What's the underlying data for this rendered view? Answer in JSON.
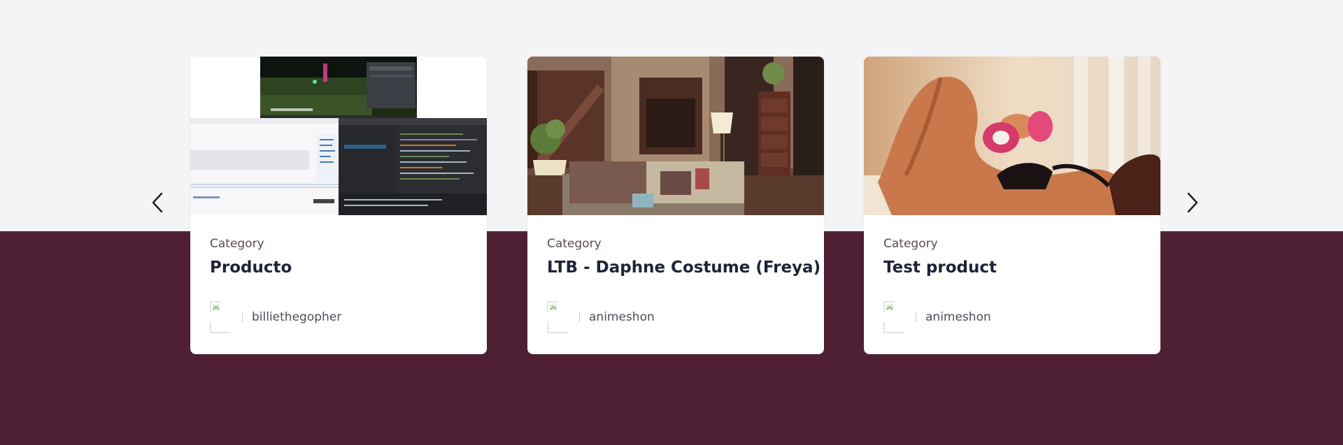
{
  "colors": {
    "page_background_top": "#f4f4f6",
    "page_background_bottom": "#4f2035",
    "card_background": "#ffffff",
    "title_color": "#1f2337",
    "category_color": "#5b4a52"
  },
  "carousel": {
    "prev_icon": "chevron-left-icon",
    "next_icon": "chevron-right-icon",
    "cards": [
      {
        "category": "Category",
        "title": "Producto",
        "author": "billiethegopher",
        "image_icon": "product-screenshot-image"
      },
      {
        "category": "Category",
        "title": "LTB - Daphne Costume (Freya)",
        "author": "animeshon",
        "image_icon": "room-interior-image"
      },
      {
        "category": "Category",
        "title": "Test product",
        "author": "animeshon",
        "image_icon": "figure-render-image"
      }
    ]
  }
}
